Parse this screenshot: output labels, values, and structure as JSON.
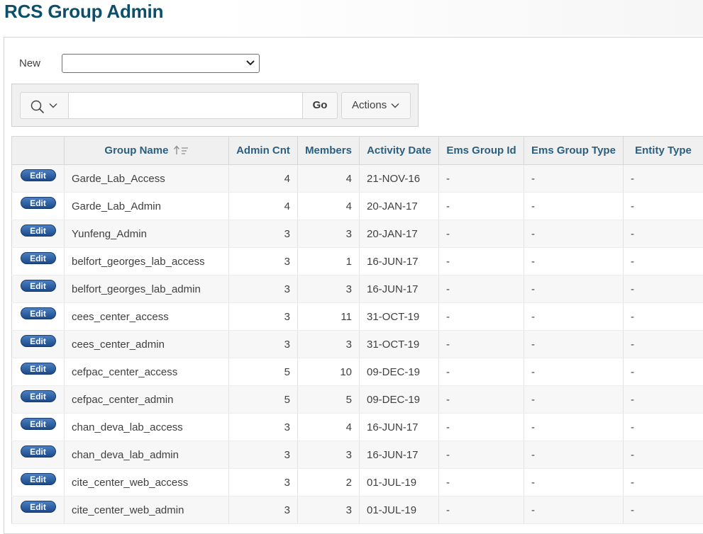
{
  "page": {
    "title": "RCS Group Admin"
  },
  "new_select": {
    "label": "New",
    "value": ""
  },
  "toolbar": {
    "search_icon": "search-icon",
    "search_value": "",
    "go_label": "Go",
    "actions_label": "Actions"
  },
  "table": {
    "columns": [
      "",
      "Group Name",
      "Admin Cnt",
      "Members",
      "Activity Date",
      "Ems Group Id",
      "Ems Group Type",
      "Entity Type"
    ],
    "sorted_column": "Group Name",
    "edit_label": "Edit",
    "rows": [
      {
        "group_name": "Garde_Lab_Access",
        "admin_cnt": "4",
        "members": "4",
        "activity_date": "21-NOV-16",
        "ems_group_id": "-",
        "ems_group_type": "-",
        "entity_type": "-"
      },
      {
        "group_name": "Garde_Lab_Admin",
        "admin_cnt": "4",
        "members": "4",
        "activity_date": "20-JAN-17",
        "ems_group_id": "-",
        "ems_group_type": "-",
        "entity_type": "-"
      },
      {
        "group_name": "Yunfeng_Admin",
        "admin_cnt": "3",
        "members": "3",
        "activity_date": "20-JAN-17",
        "ems_group_id": "-",
        "ems_group_type": "-",
        "entity_type": "-"
      },
      {
        "group_name": "belfort_georges_lab_access",
        "admin_cnt": "3",
        "members": "1",
        "activity_date": "16-JUN-17",
        "ems_group_id": "-",
        "ems_group_type": "-",
        "entity_type": "-"
      },
      {
        "group_name": "belfort_georges_lab_admin",
        "admin_cnt": "3",
        "members": "3",
        "activity_date": "16-JUN-17",
        "ems_group_id": "-",
        "ems_group_type": "-",
        "entity_type": "-"
      },
      {
        "group_name": "cees_center_access",
        "admin_cnt": "3",
        "members": "11",
        "activity_date": "31-OCT-19",
        "ems_group_id": "-",
        "ems_group_type": "-",
        "entity_type": "-"
      },
      {
        "group_name": "cees_center_admin",
        "admin_cnt": "3",
        "members": "3",
        "activity_date": "31-OCT-19",
        "ems_group_id": "-",
        "ems_group_type": "-",
        "entity_type": "-"
      },
      {
        "group_name": "cefpac_center_access",
        "admin_cnt": "5",
        "members": "10",
        "activity_date": "09-DEC-19",
        "ems_group_id": "-",
        "ems_group_type": "-",
        "entity_type": "-"
      },
      {
        "group_name": "cefpac_center_admin",
        "admin_cnt": "5",
        "members": "5",
        "activity_date": "09-DEC-19",
        "ems_group_id": "-",
        "ems_group_type": "-",
        "entity_type": "-"
      },
      {
        "group_name": "chan_deva_lab_access",
        "admin_cnt": "3",
        "members": "4",
        "activity_date": "16-JUN-17",
        "ems_group_id": "-",
        "ems_group_type": "-",
        "entity_type": "-"
      },
      {
        "group_name": "chan_deva_lab_admin",
        "admin_cnt": "3",
        "members": "3",
        "activity_date": "16-JUN-17",
        "ems_group_id": "-",
        "ems_group_type": "-",
        "entity_type": "-"
      },
      {
        "group_name": "cite_center_web_access",
        "admin_cnt": "3",
        "members": "2",
        "activity_date": "01-JUL-19",
        "ems_group_id": "-",
        "ems_group_type": "-",
        "entity_type": "-"
      },
      {
        "group_name": "cite_center_web_admin",
        "admin_cnt": "3",
        "members": "3",
        "activity_date": "01-JUL-19",
        "ems_group_id": "-",
        "ems_group_type": "-",
        "entity_type": "-"
      }
    ]
  }
}
